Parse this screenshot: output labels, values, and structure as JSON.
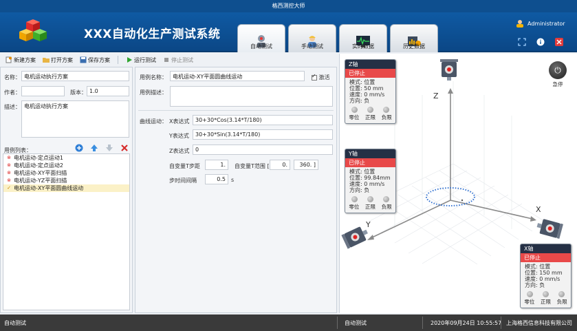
{
  "window": {
    "title": "格西测控大师"
  },
  "header": {
    "app_title": "XXX自动化生产测试系统",
    "tabs": [
      {
        "label": "自动测试",
        "icon": "robot-icon"
      },
      {
        "label": "手动测试",
        "icon": "worker-icon"
      },
      {
        "label": "实时数据",
        "icon": "waveform-monitor-icon"
      },
      {
        "label": "历史数据",
        "icon": "database-history-icon"
      }
    ],
    "user": "Administrator"
  },
  "toolbar": {
    "new_label": "新建方案",
    "open_label": "打开方案",
    "save_label": "保存方案",
    "run_label": "运行测试",
    "stop_label": "停止测试"
  },
  "plan": {
    "name_label": "名称：",
    "name_value": "电机运动执行方案",
    "author_label": "作者：",
    "author_value": "",
    "version_label": "版本：",
    "version_value": "1.0",
    "desc_label": "描述：",
    "desc_value": "电机运动执行方案",
    "list_label": "用例列表：",
    "cases": [
      "电机运动-定点运动1",
      "电机运动-定点运动2",
      "电机运动-XY平面扫描",
      "电机运动-YZ平面扫描",
      "电机运动-XY平面圆曲线运动"
    ],
    "selected_case_index": 4
  },
  "case": {
    "name_label": "用例名称：",
    "name_value": "电机运动-XY平面圆曲线运动",
    "active_label": "激活",
    "desc_label": "用例描述：",
    "curve_label": "曲线运动：",
    "x_label": "X表达式",
    "x_value": "30+30*Cos(3.14*T/180)",
    "y_label": "Y表达式",
    "y_value": "30+30*Sin(3.14*T/180)",
    "z_label": "Z表达式",
    "z_value": "0",
    "tstep_label": "自变量T步距",
    "tstep_value": "1.",
    "trange_label": "自变量T范围 [",
    "trange_from": "0.",
    "trange_to": "360. ]",
    "interval_label": "步时间间隔",
    "interval_value": "0.5",
    "interval_unit": "s"
  },
  "axes": {
    "emergency_label": "急停",
    "z": {
      "title": "Z轴",
      "state": "已停止",
      "mode": "模式: 位置",
      "position": "位置:  50    mm",
      "speed": "速度:  0      mm/s",
      "direction": "方向: 负",
      "leds": [
        "零位",
        "正限",
        "负限"
      ]
    },
    "y": {
      "title": "Y轴",
      "state": "已停止",
      "mode": "模式: 位置",
      "position": "位置:  99.84mm",
      "speed": "速度:  0      mm/s",
      "direction": "方向: 负",
      "leds": [
        "零位",
        "正限",
        "负限"
      ]
    },
    "x": {
      "title": "X轴",
      "state": "已停止",
      "mode": "模式: 位置",
      "position": "位置:  150   mm",
      "speed": "速度:  0      mm/s",
      "direction": "方向: 负",
      "leds": [
        "零位",
        "正限",
        "负限"
      ]
    },
    "labels": {
      "z": "Z",
      "y": "Y",
      "x": "X"
    }
  },
  "status": {
    "left": "自动测试",
    "mid": "自动测试",
    "datetime": "2020年09月24日  10:55:57",
    "company": "上海格西信息科技有限公司"
  }
}
